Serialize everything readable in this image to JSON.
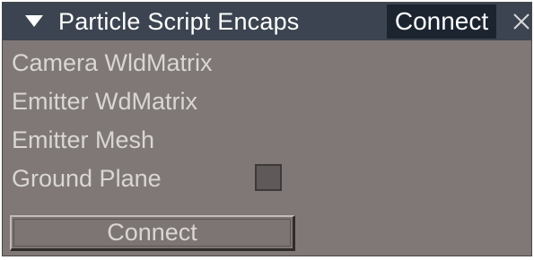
{
  "titlebar": {
    "title": "Particle Script Encaps",
    "connect_tab_label": "Connect",
    "collapse_icon": "triangle-down-icon",
    "close_icon": "close-icon"
  },
  "rows": [
    {
      "label": "Camera WldMatrix"
    },
    {
      "label": "Emitter WdMatrix"
    },
    {
      "label": "Emitter Mesh"
    },
    {
      "label": "Ground Plane"
    }
  ],
  "ground_plane_checkbox": {
    "checked": false
  },
  "connect_button": {
    "label": "Connect"
  },
  "colors": {
    "panel_bg": "#7f7876",
    "titlebar_bg": "#3b4450",
    "tab_bg": "#1c2430",
    "label_text": "#d9d6d4"
  }
}
